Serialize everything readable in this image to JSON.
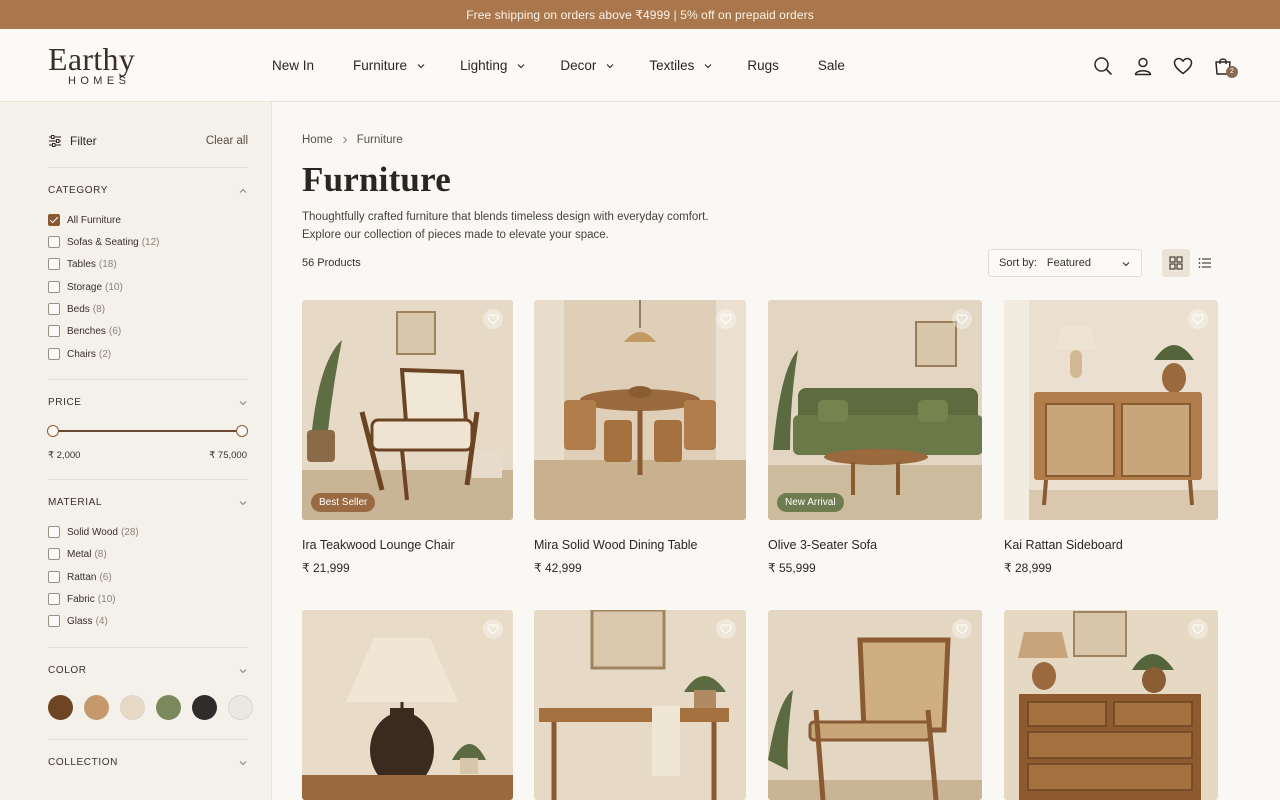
{
  "announcement": "Free shipping on orders above ₹4999 | 5% off on prepaid orders",
  "brand": {
    "name": "Earthy",
    "sub": "HOMES"
  },
  "nav": [
    {
      "label": "New In",
      "dropdown": false
    },
    {
      "label": "Furniture",
      "dropdown": true
    },
    {
      "label": "Lighting",
      "dropdown": true
    },
    {
      "label": "Decor",
      "dropdown": true
    },
    {
      "label": "Textiles",
      "dropdown": true
    },
    {
      "label": "Rugs",
      "dropdown": false
    },
    {
      "label": "Sale",
      "dropdown": false
    }
  ],
  "header_icons": [
    "search-icon",
    "user-icon",
    "heart-icon",
    "cart-icon"
  ],
  "cart_count": "2",
  "filters": {
    "title": "Filter",
    "clear_all": "Clear all",
    "category": {
      "title": "CATEGORY",
      "items": [
        {
          "label": "All Furniture",
          "count": "",
          "checked": true
        },
        {
          "label": "Sofas & Seating",
          "count": "(12)",
          "checked": false
        },
        {
          "label": "Tables",
          "count": "(18)",
          "checked": false
        },
        {
          "label": "Storage",
          "count": "(10)",
          "checked": false
        },
        {
          "label": "Beds",
          "count": "(8)",
          "checked": false
        },
        {
          "label": "Benches",
          "count": "(6)",
          "checked": false
        },
        {
          "label": "Chairs",
          "count": "(2)",
          "checked": false
        }
      ]
    },
    "price": {
      "title": "PRICE",
      "min_label": "₹ 2,000",
      "max_label": "₹ 75,000"
    },
    "material": {
      "title": "MATERIAL",
      "items": [
        {
          "label": "Solid Wood",
          "count": "(28)",
          "checked": false
        },
        {
          "label": "Metal",
          "count": "(8)",
          "checked": false
        },
        {
          "label": "Rattan",
          "count": "(6)",
          "checked": false
        },
        {
          "label": "Fabric",
          "count": "(10)",
          "checked": false
        },
        {
          "label": "Glass",
          "count": "(4)",
          "checked": false
        }
      ]
    },
    "color": {
      "title": "COLOR",
      "swatches": [
        "#6e4424",
        "#c6996c",
        "#e6d9c6",
        "#7a8a5c",
        "#2f2d2b",
        "#ebe8e3"
      ]
    },
    "collection": {
      "title": "COLLECTION"
    }
  },
  "breadcrumb": [
    "Home",
    "Furniture"
  ],
  "page_title": "Furniture",
  "description_line1": "Thoughtfully crafted furniture that blends timeless design with everyday comfort.",
  "description_line2": "Explore our collection of pieces made to elevate your space.",
  "product_count": "56 Products",
  "sort": {
    "label": "Sort by:",
    "value": "Featured"
  },
  "products": [
    {
      "name": "Ira Teakwood Lounge Chair",
      "price": "₹ 21,999",
      "badge": "Best Seller",
      "badge_color": "#9a6a43"
    },
    {
      "name": "Mira Solid Wood Dining Table",
      "price": "₹ 42,999",
      "badge": "",
      "badge_color": ""
    },
    {
      "name": "Olive 3-Seater Sofa",
      "price": "₹ 55,999",
      "badge": "New Arrival",
      "badge_color": "#6f7c4f"
    },
    {
      "name": "Kai Rattan Sideboard",
      "price": "₹ 28,999",
      "badge": "",
      "badge_color": ""
    },
    {
      "name": "",
      "price": "",
      "badge": "",
      "badge_color": ""
    },
    {
      "name": "",
      "price": "",
      "badge": "",
      "badge_color": ""
    },
    {
      "name": "",
      "price": "",
      "badge": "",
      "badge_color": ""
    },
    {
      "name": "",
      "price": "",
      "badge": "",
      "badge_color": ""
    }
  ]
}
